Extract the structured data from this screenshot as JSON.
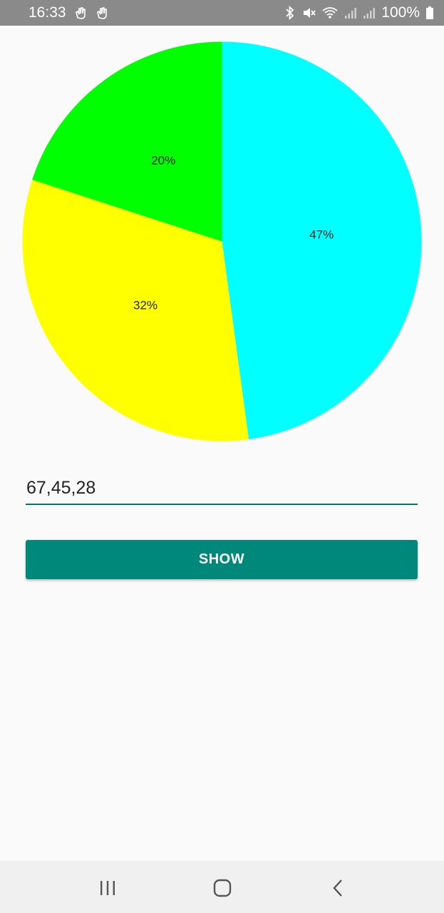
{
  "status_bar": {
    "time": "16:33",
    "battery": "100%",
    "left_icons": [
      "hand-wave-icon",
      "hand-wave-icon"
    ],
    "right_icons": [
      "bluetooth-icon",
      "mute-icon",
      "wifi-icon",
      "signal-icon",
      "signal-icon",
      "battery-icon"
    ]
  },
  "chart_data": {
    "type": "pie",
    "values": [
      67,
      45,
      28
    ],
    "labels": [
      "47%",
      "32%",
      "20%"
    ],
    "colors": [
      "#00ffff",
      "#ffff00",
      "#00ff00"
    ],
    "start": "top",
    "direction": "clockwise"
  },
  "input": {
    "value": "67,45,28"
  },
  "button": {
    "label": "SHOW",
    "color": "#00897b"
  },
  "nav_bar": {
    "buttons": [
      "recents-icon",
      "home-icon",
      "back-icon"
    ]
  }
}
